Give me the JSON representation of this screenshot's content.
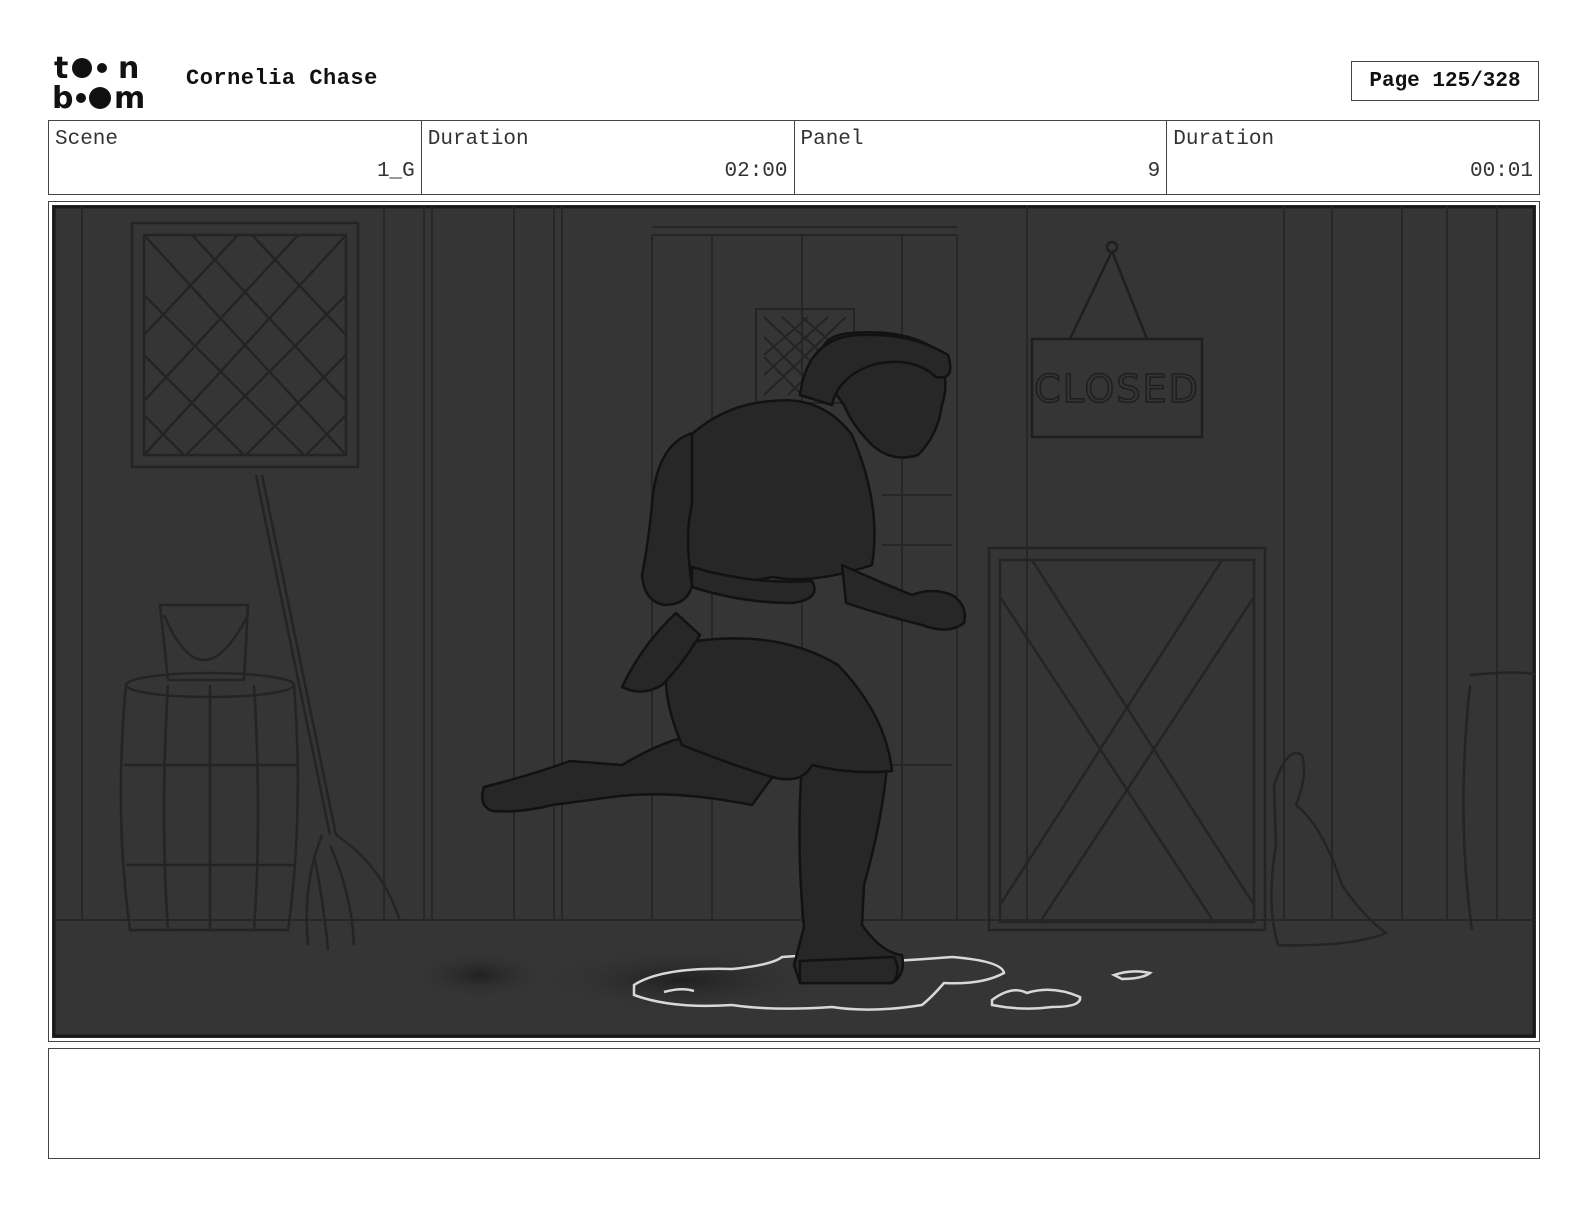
{
  "header": {
    "logo_text": "toon boom",
    "project_title": "Cornelia Chase",
    "page_label": "Page 125/328"
  },
  "info": {
    "scene_label": "Scene",
    "scene_value": "1_G",
    "scene_duration_label": "Duration",
    "scene_duration_value": "02:00",
    "panel_label": "Panel",
    "panel_value": "9",
    "panel_duration_label": "Duration",
    "panel_duration_value": "00:01"
  },
  "panel": {
    "sign_text": "CLOSED"
  },
  "notes": {
    "text": ""
  }
}
